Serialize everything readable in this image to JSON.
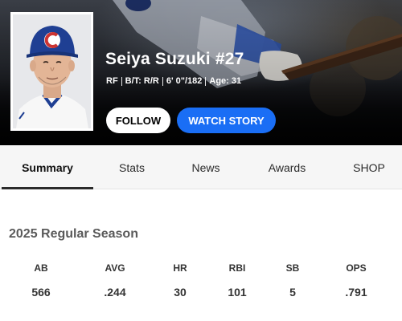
{
  "player": {
    "name": "Seiya Suzuki #27",
    "position": "RF",
    "bats_throws": "B/T: R/R",
    "height_weight": "6' 0\"/182",
    "age": "Age: 31"
  },
  "actions": {
    "follow_label": "FOLLOW",
    "watch_story_label": "WATCH STORY"
  },
  "tabs": [
    {
      "label": "Summary",
      "active": true
    },
    {
      "label": "Stats",
      "active": false
    },
    {
      "label": "News",
      "active": false
    },
    {
      "label": "Awards",
      "active": false
    },
    {
      "label": "SHOP",
      "active": false
    }
  ],
  "season": {
    "title": "2025 Regular Season",
    "stats": [
      {
        "label": "AB",
        "value": "566"
      },
      {
        "label": "AVG",
        "value": ".244"
      },
      {
        "label": "HR",
        "value": "30"
      },
      {
        "label": "RBI",
        "value": "101"
      },
      {
        "label": "SB",
        "value": "5"
      },
      {
        "label": "OPS",
        "value": ".791"
      }
    ]
  },
  "colors": {
    "accent_blue": "#1a6ef5",
    "cap_blue": "#1f3f93",
    "logo_red": "#cc3433"
  },
  "icons": {
    "headshot": "player-headshot",
    "cap_logo": "cubs-c-logo"
  }
}
